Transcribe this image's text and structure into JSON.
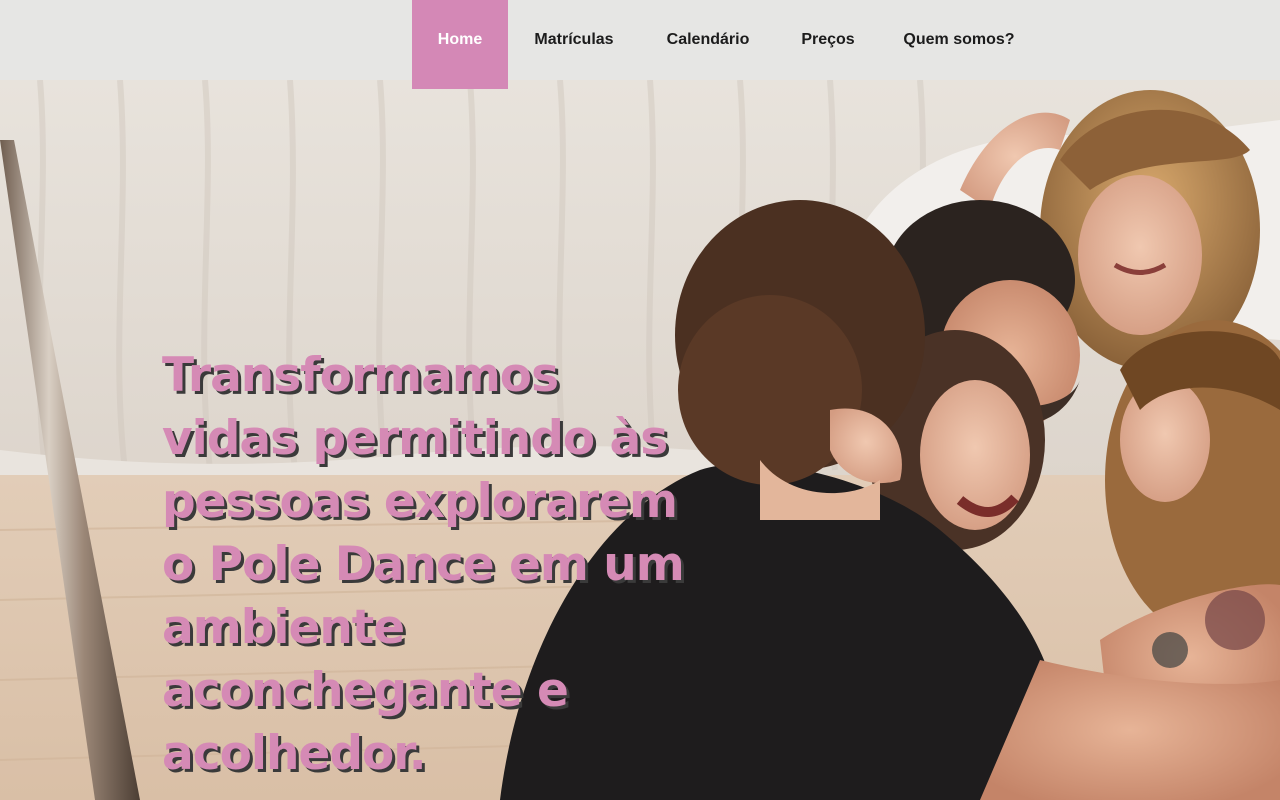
{
  "nav": {
    "items": [
      {
        "label": "Home",
        "active": true
      },
      {
        "label": "Matrículas",
        "active": false
      },
      {
        "label": "Calendário",
        "active": false
      },
      {
        "label": "Preços",
        "active": false
      },
      {
        "label": "Quem somos?",
        "active": false
      }
    ]
  },
  "hero": {
    "headline": "Transformamos vidas permitindo às pessoas explorarem o Pole Dance em um ambiente aconchegante e acolhedor.",
    "image_alt": "group-hug-photo"
  },
  "colors": {
    "accent": "#d488b6",
    "headline": "#d58ab5",
    "nav_bg": "#e6e6e4"
  }
}
